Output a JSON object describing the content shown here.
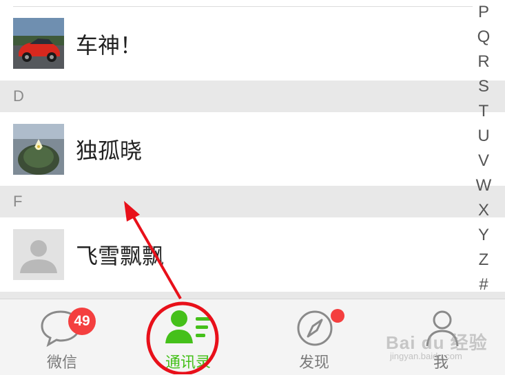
{
  "contacts": [
    {
      "name": "车神！",
      "avatar": "car-photo-avatar"
    },
    {
      "name": "独孤晓",
      "avatar": "cactus-photo-avatar"
    },
    {
      "name": "飞雪飘飘",
      "avatar": "default-person-avatar"
    }
  ],
  "sections": [
    "D",
    "F"
  ],
  "index_letters": [
    "P",
    "Q",
    "R",
    "S",
    "T",
    "U",
    "V",
    "W",
    "X",
    "Y",
    "Z",
    "#"
  ],
  "tabs": [
    {
      "label": "微信",
      "icon": "chat-bubble-icon",
      "badge": "49"
    },
    {
      "label": "通讯录",
      "icon": "contacts-icon",
      "active": true
    },
    {
      "label": "发现",
      "icon": "compass-icon",
      "dot": true
    },
    {
      "label": "我",
      "icon": "person-outline-icon"
    }
  ],
  "watermark": {
    "main": "Bai du 经验",
    "sub": "jingyan.baidu.com"
  },
  "colors": {
    "accent": "#45c01a",
    "badge": "#f43f3f",
    "annotation": "#e8101a"
  }
}
